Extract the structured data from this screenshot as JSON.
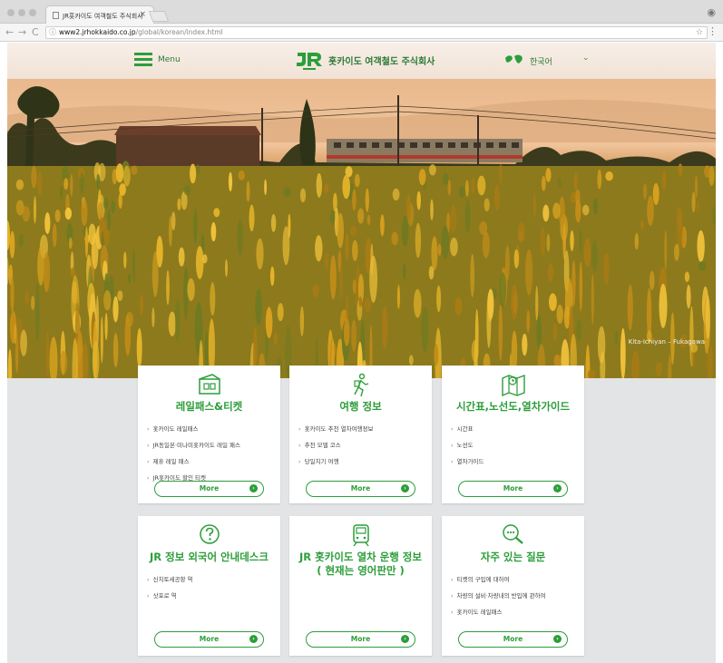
{
  "browser": {
    "tab_title": "JR홋카이도 여객철도 주식회사",
    "tab_close": "×",
    "url_host": "www2.jrhokkaido.co.jp",
    "url_path": "/global/korean/index.html",
    "nav_back": "←",
    "nav_forward": "→",
    "nav_reload": "C",
    "info_icon": "ⓘ",
    "star_icon": "☆",
    "menu_icon": "⋮",
    "profile_icon": "◉"
  },
  "header": {
    "menu_label": "Menu",
    "company_name": "홋카이도 여객철도 주식회사",
    "logo_text": "JR",
    "language_label": "한국어",
    "language_chevron": "⌄",
    "language_icon": "globe-icon"
  },
  "hero": {
    "caption": "Kita-Ichiyan – Fukagawa"
  },
  "cards": [
    {
      "icon": "rail-pass-icon",
      "title": "레일패스&티켓",
      "links": [
        "홋카이도 레일패스",
        "JR동일본·미나미홋카이도 레일 패스",
        "제휴 레일 패스",
        "JR홋카이도 할인 티켓"
      ],
      "more": "More"
    },
    {
      "icon": "traveler-icon",
      "title": "여행 정보",
      "links": [
        "홋카이도 추천 열차여행정보",
        "추천 모델 코스",
        "당일치기 여행"
      ],
      "more": "More"
    },
    {
      "icon": "map-clock-icon",
      "title": "시간표,노선도,열차가이드",
      "links": [
        "시간표",
        "노선도",
        "열차가이드"
      ],
      "more": "More"
    },
    {
      "icon": "question-icon",
      "title": "JR 정보 외국어 안내데스크",
      "links": [
        "신치토세공항 역",
        "삿포로 역"
      ],
      "more": "More"
    },
    {
      "icon": "train-icon",
      "title": "JR 홋카이도 열차 운행 정보\n( 현재는 영어판만 )",
      "links": [],
      "more": "More"
    },
    {
      "icon": "faq-search-icon",
      "title": "자주 있는 질문",
      "links": [
        "티켓의 구입에 대하여",
        "차량의 설비·차량내의 반입에 관하여",
        "홋카이도 레일패스"
      ],
      "more": "More"
    }
  ],
  "colors": {
    "brand_green": "#2c9e3a",
    "page_bg": "#e3e4e6",
    "card_bg": "#ffffff"
  }
}
